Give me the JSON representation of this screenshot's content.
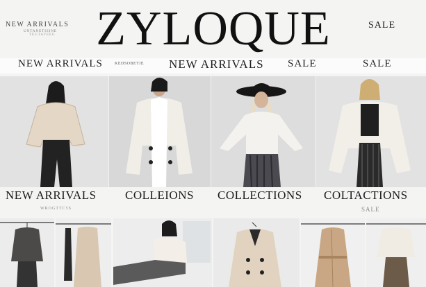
{
  "brand": {
    "name": "ZYLOQUE"
  },
  "header": {
    "top_left": {
      "line1": "NEW ARRIVALS",
      "line2": "UNTANETISINE",
      "line3": "TEGTAVEEG"
    },
    "top_right_sale": "SALE"
  },
  "nav": {
    "items": [
      "NEW ARRIVALS",
      "NEW ARRIVALS",
      "SALE",
      "SALE"
    ],
    "small_text": "KEDSOBETIE"
  },
  "categories": {
    "labels": [
      "NEW ARRIVALS",
      "COLLEIONS",
      "COLLECTIONS",
      "COLTACTIONS"
    ],
    "sublabels": [
      "WROGTTC5S",
      "SALE"
    ]
  },
  "icons": {
    "hero_1": "woman-lace-sweater-icon",
    "hero_2": "woman-white-coat-icon",
    "hero_3": "woman-hat-knit-icon",
    "hero_4": "woman-cardigan-icon",
    "tile_1": "hanging-knit-outfit-icon",
    "tile_2": "hanging-dresses-icon",
    "tile_3": "woman-reclining-icon",
    "tile_4": "double-breasted-coat-icon",
    "tile_5": "trench-coat-icon",
    "tile_6": "hanging-blouse-skirt-icon"
  },
  "colors": {
    "accent": "#111111",
    "background": "#f4f4f3",
    "photo_bg": "#dcdcdc"
  }
}
